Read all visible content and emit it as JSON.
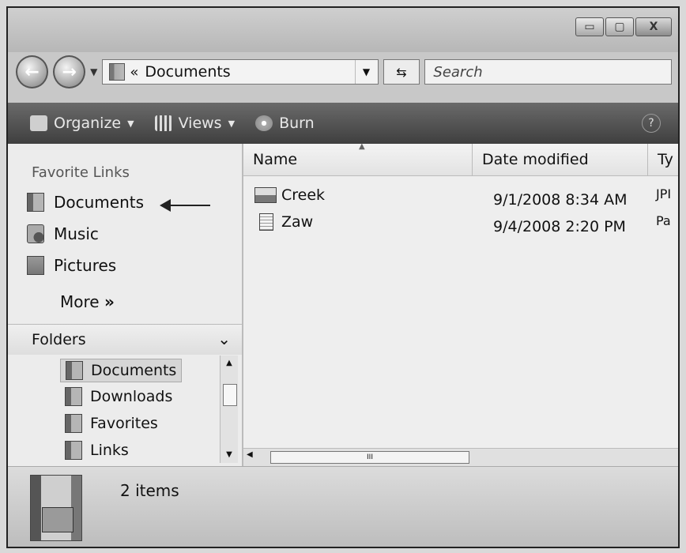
{
  "window": {
    "caption_buttons": {
      "minimize": "▭",
      "maximize": "▢",
      "close": "X"
    }
  },
  "nav": {
    "back_icon": "back-arrow-icon",
    "forward_icon": "forward-arrow-icon",
    "address_chevron": "«",
    "address_path": "Documents",
    "refresh_glyph": "⇆",
    "search_placeholder": "Search"
  },
  "toolbar": {
    "organize": "Organize",
    "views": "Views",
    "burn": "Burn",
    "help": "?"
  },
  "sidebar": {
    "favorite_links_title": "Favorite Links",
    "favorites": [
      {
        "label": "Documents",
        "icon": "documents-icon"
      },
      {
        "label": "Music",
        "icon": "music-icon"
      },
      {
        "label": "Pictures",
        "icon": "pictures-icon"
      }
    ],
    "more_label": "More",
    "more_glyph": "»",
    "folders_title": "Folders",
    "folders_chevron": "⌄",
    "tree": [
      {
        "label": "Documents",
        "selected": true
      },
      {
        "label": "Downloads",
        "selected": false
      },
      {
        "label": "Favorites",
        "selected": false
      },
      {
        "label": "Links",
        "selected": false
      }
    ]
  },
  "file_list": {
    "columns": [
      "Name",
      "Date modified",
      "Ty"
    ],
    "rows": [
      {
        "name": "Creek",
        "date": "9/1/2008 8:34 AM",
        "type": "JPI",
        "icon": "image-file-icon"
      },
      {
        "name": "Zaw",
        "date": "9/4/2008 2:20 PM",
        "type": "Pa",
        "icon": "text-file-icon"
      }
    ],
    "hscroll_grip": "III"
  },
  "details_pane": {
    "item_count": "2 items"
  }
}
